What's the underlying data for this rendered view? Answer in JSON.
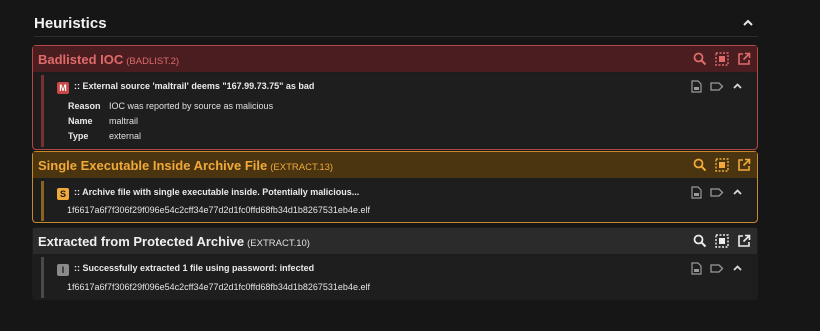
{
  "heading": "Heuristics",
  "colors": {
    "bad": "#c94848",
    "bad_bg": "#4a1e20",
    "warn": "#f0a93a",
    "warn_bg": "#4a3510",
    "info_bg": "#2b2b2b",
    "info_stripe": "#4a4a4a"
  },
  "sections": [
    {
      "title": "Badlisted IOC",
      "code": "(BADLIST.2)",
      "result": {
        "badge": "M",
        "text": ":: External source 'maltrail' deems \"167.99.73.75\" as bad",
        "fields": [
          {
            "key": "Reason",
            "value": "IOC was reported by source as malicious"
          },
          {
            "key": "Name",
            "value": "maltrail"
          },
          {
            "key": "Type",
            "value": "external"
          }
        ]
      }
    },
    {
      "title": "Single Executable Inside Archive File",
      "code": "(EXTRACT.13)",
      "result": {
        "badge": "S",
        "text": ":: Archive file with single executable inside. Potentially malicious...",
        "hash": "1f6617a6f7f306f29f096e54c2cff34e77d2d1fc0ffd68fb34d1b8267531eb4e.elf"
      }
    },
    {
      "title": "Extracted from Protected Archive",
      "code": "(EXTRACT.10)",
      "result": {
        "badge": "I",
        "text": ":: Successfully extracted 1 file using password: infected",
        "hash": "1f6617a6f7f306f29f096e54c2cff34e77d2d1fc0ffd68fb34d1b8267531eb4e.elf"
      }
    }
  ]
}
